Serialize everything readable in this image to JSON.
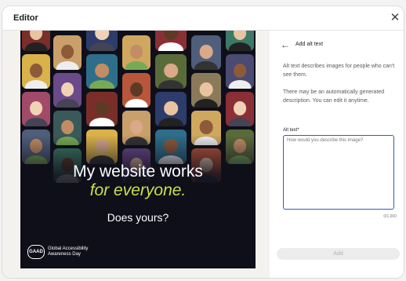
{
  "header": {
    "title": "Editor",
    "close_icon": "close-icon"
  },
  "image": {
    "headline_line1": "My website works",
    "headline_line2": "for everyone.",
    "subline": "Does yours?",
    "logo_badge": "GAAD",
    "logo_text_line1": "Global Accessibility",
    "logo_text_line2": "Awareness Day",
    "accent_color": "#c9e14a"
  },
  "panel": {
    "back_icon": "arrow-left-icon",
    "title": "Add alt text",
    "description_1": "Alt text describes images for people who can't see them.",
    "description_2": "There may be an automatically generated description. You can edit it anytime.",
    "field_label": "Alt text*",
    "placeholder": "How would you describe this image?",
    "value": "",
    "counter": "0/1,000",
    "add_label": "Add",
    "focus_color": "#2c5db8"
  }
}
